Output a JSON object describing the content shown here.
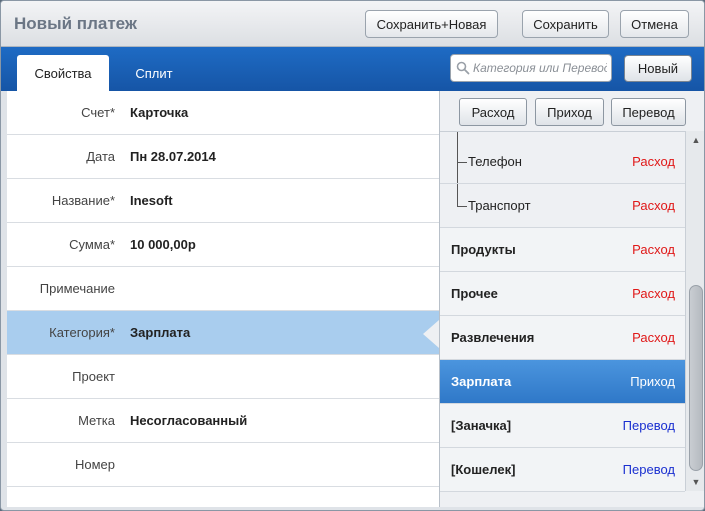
{
  "window": {
    "title": "Новый платеж",
    "buttons": {
      "save_new": "Сохранить+Новая",
      "save": "Сохранить",
      "cancel": "Отмена"
    }
  },
  "tabs": [
    {
      "label": "Свойства",
      "active": true
    },
    {
      "label": "Сплит",
      "active": false
    }
  ],
  "search": {
    "placeholder": "Категория или Перевод",
    "value": "",
    "icon": "search-icon"
  },
  "new_button": "Новый",
  "form": {
    "fields": [
      {
        "label": "Счет*",
        "value": "Карточка"
      },
      {
        "label": "Дата",
        "value": "Пн 28.07.2014"
      },
      {
        "label": "Название*",
        "value": "Inesoft"
      },
      {
        "label": "Сумма*",
        "value": "10 000,00р"
      },
      {
        "label": "Примечание",
        "value": ""
      },
      {
        "label": "Категория*",
        "value": "Зарплата",
        "selected": true
      },
      {
        "label": "Проект",
        "value": ""
      },
      {
        "label": "Метка",
        "value": "Несогласованный"
      },
      {
        "label": "Номер",
        "value": ""
      }
    ]
  },
  "filters": {
    "expense": "Расход",
    "income": "Приход",
    "transfer": "Перевод"
  },
  "categories": [
    {
      "name": "Телефон",
      "type": "Расход",
      "kind": "expense",
      "level": "child"
    },
    {
      "name": "Транспорт",
      "type": "Расход",
      "kind": "expense",
      "level": "child"
    },
    {
      "name": "Продукты",
      "type": "Расход",
      "kind": "expense",
      "level": "top"
    },
    {
      "name": "Прочее",
      "type": "Расход",
      "kind": "expense",
      "level": "top"
    },
    {
      "name": "Развлечения",
      "type": "Расход",
      "kind": "expense",
      "level": "top"
    },
    {
      "name": "Зарплата",
      "type": "Приход",
      "kind": "income",
      "level": "top",
      "selected": true
    },
    {
      "name": "[Заначка]",
      "type": "Перевод",
      "kind": "transfer",
      "level": "top"
    },
    {
      "name": "[Кошелек]",
      "type": "Перевод",
      "kind": "transfer",
      "level": "top"
    }
  ],
  "colors": {
    "accent": "#1b60b5",
    "selected_row": "#a9cdee",
    "selected_category": "#3a85d2",
    "expense": "#e01818",
    "transfer": "#1a2fd0"
  }
}
